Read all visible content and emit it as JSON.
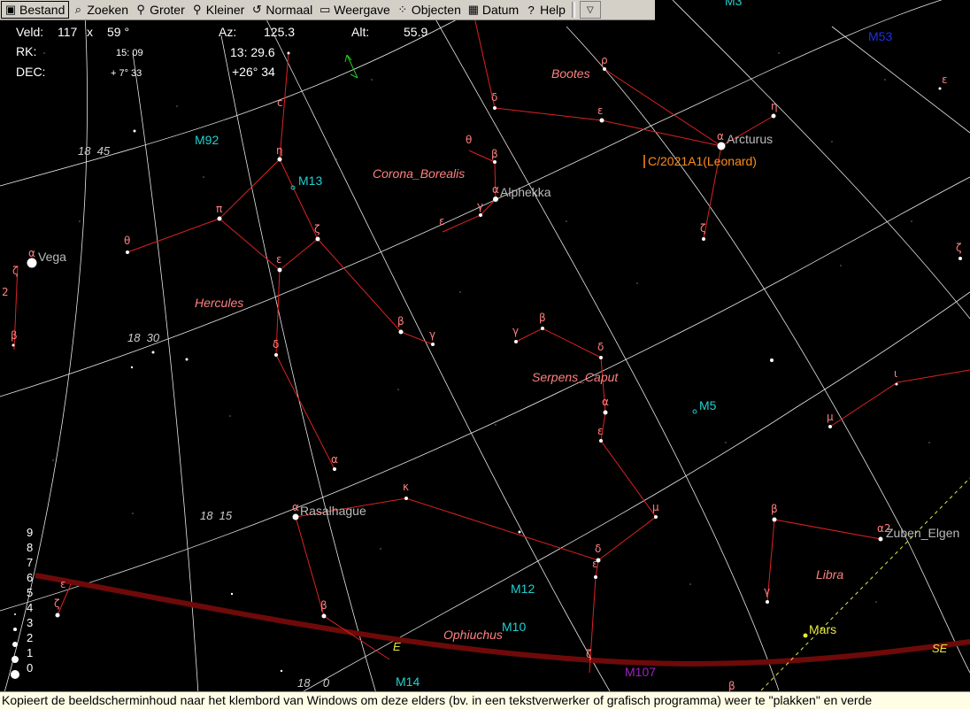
{
  "menu": [
    {
      "label": "Bestand",
      "icon": "save-icon",
      "glyph": "▣"
    },
    {
      "label": "Zoeken",
      "icon": "binoculars-icon",
      "glyph": "⌕"
    },
    {
      "label": "Groter",
      "icon": "zoom-in-icon",
      "glyph": "⚲"
    },
    {
      "label": "Kleiner",
      "icon": "zoom-out-icon",
      "glyph": "⚲"
    },
    {
      "label": "Normaal",
      "icon": "reset-icon",
      "glyph": "↺"
    },
    {
      "label": "Weergave",
      "icon": "monitor-icon",
      "glyph": "▭"
    },
    {
      "label": "Objecten",
      "icon": "objects-icon",
      "glyph": "⁘"
    },
    {
      "label": "Datum",
      "icon": "calendar-icon",
      "glyph": "▦"
    },
    {
      "label": "Help",
      "icon": "help-icon",
      "glyph": "?"
    }
  ],
  "info": {
    "veld_label": "Veld:",
    "veld_w": "117",
    "veld_x": "x",
    "veld_h": "59 °",
    "rk_label": "RK:",
    "rk_value": "15: 09",
    "dec_label": "DEC:",
    "dec_value": "+ 7° 33",
    "az_label": "Az:",
    "az_value": "125.3",
    "alt_label": "Alt:",
    "alt_value": "55.9",
    "ra_value": "13: 29.6",
    "decl_value": "+26° 34"
  },
  "sky": {
    "constellations": [
      "Bootes",
      "Corona_Borealis",
      "Hercules",
      "Serpens_Caput",
      "Libra",
      "Ophiuchus"
    ],
    "stars": [
      "Arcturus",
      "Alphekka",
      "Vega",
      "Rasalhague",
      "Zuben_Elgen"
    ],
    "messier": [
      "M92",
      "M13",
      "M5",
      "M12",
      "M10",
      "M14",
      "M107",
      "M3",
      "M53"
    ],
    "comet": "C/2021A1(Leonard)",
    "planet": "Mars",
    "directions": [
      "E",
      "SE"
    ],
    "grid_labels": [
      "18  45",
      "18  30",
      "18  15",
      "18    0"
    ]
  },
  "magnitude_scale": [
    "9",
    "8",
    "7",
    "6",
    "5",
    "4",
    "3",
    "2",
    "1",
    "0"
  ],
  "status": "Kopieert de beeldscherminhoud naar het klembord van Windows om deze elders (bv. in een tekstverwerker of grafisch programma) weer te \"plakken\" en verde"
}
